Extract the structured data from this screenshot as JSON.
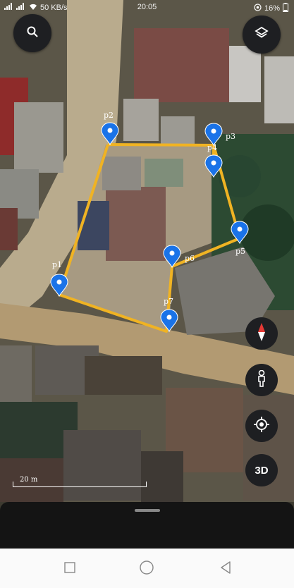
{
  "status_bar": {
    "speed": "50 KB/s",
    "time": "20:05",
    "battery": "16%"
  },
  "map": {
    "points": [
      {
        "label": "p1"
      },
      {
        "label": "p2"
      },
      {
        "label": "p3"
      },
      {
        "label": "p4"
      },
      {
        "label": "p5"
      },
      {
        "label": "p6"
      },
      {
        "label": "p7"
      }
    ],
    "scale_label": "20 m",
    "boundary_color": "#f0b323",
    "pin_color": "#1a73e8"
  },
  "controls": {
    "search_icon": "search-icon",
    "layers_icon": "layers-icon",
    "compass_icon": "compass-icon",
    "pegman_icon": "pegman-icon",
    "location_icon": "my-location-icon",
    "btn_3d_label": "3D"
  },
  "nav": {
    "back_icon": "back-icon",
    "home_icon": "home-icon",
    "recents_icon": "recents-icon"
  }
}
